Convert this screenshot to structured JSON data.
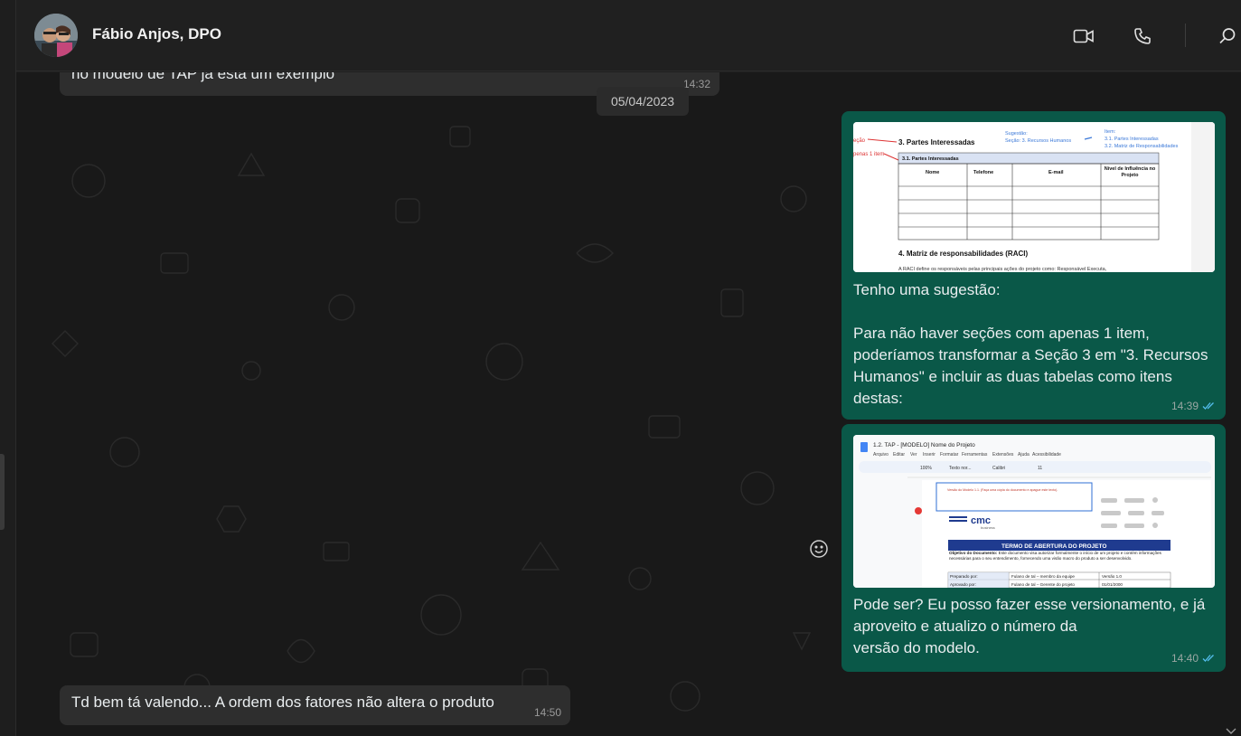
{
  "header": {
    "contact_name": "Fábio Anjos, DPO"
  },
  "messages": {
    "m1": {
      "text": "no modelo de TAP já está um exemplo",
      "time": "14:32"
    },
    "date_separator": "05/04/2023",
    "m2": {
      "text": "Tenho uma sugestão:\n\nPara não haver seções com apenas 1 item, poderíamos transformar a Seção 3 em \"3. Recursos Humanos\" e incluir as duas tabelas como itens destas:",
      "time": "14:39",
      "image": {
        "annot_left_1": "eção",
        "annot_left_2": "penas 1 item",
        "heading": "3. Partes Interessadas",
        "suggestion_title": "Sugestão:",
        "suggestion_text": "Seção: 3. Recursos Humanos",
        "item_title": "Item:",
        "item_1": "3.1. Partes Interessadas",
        "item_2": "3.2. Matriz de Responsabilidades",
        "subheading": "3.1. Partes Interessadas",
        "table_headers": [
          "Nome",
          "Telefone",
          "E-mail",
          "Nível de Influência no Projeto"
        ],
        "section_4": "4. Matriz de responsabilidades (RACI)",
        "section_4_text": "A RACI define os responsáveis pelas principais ações do projeto como: Responsável Executa,"
      }
    },
    "m3": {
      "text": "Pode ser? Eu posso fazer esse versionamento, e já aproveito e atualizo o número da\nversão do modelo.",
      "time": "14:40",
      "image": {
        "doc_title": "1.2. TAP - [MODELO] Nome do Projeto",
        "menu": [
          "Arquivo",
          "Editar",
          "Ver",
          "Inserir",
          "Formatar",
          "Ferramentas",
          "Extensões",
          "Ajuda",
          "Acessibilidade"
        ],
        "zoom": "100%",
        "style": "Texto nor...",
        "font": "Calibri",
        "font_size": "11",
        "version_note": "Versão do Modelo 1.1. (Faça uma cópia do documento e apague este texto).",
        "logo": "cmc",
        "logo_sub": "business",
        "banner": "TERMO DE ABERTURA DO PROJETO",
        "objective_label": "Objetivo do Documento:",
        "objective_text": "Este documento visa autorizar formalmente o início de um projeto e contém informações necessárias para o seu entendimento, fornecendo uma visão macro do produto a ser desenvolvido.",
        "prepared_label": "Preparado por:",
        "prepared_value": "Fulano de tal – membro da equipe",
        "version_value": "Versão 1.0",
        "approved_label": "Aprovado por:",
        "approved_value": "Fulano de tal – Gerente do projeto",
        "date_value": "01/01/2000"
      }
    },
    "m4": {
      "text": "Td bem tá valendo... A ordem dos fatores não altera o produto",
      "time": "14:50"
    }
  },
  "colors": {
    "outgoing_bubble": "#0a5848",
    "incoming_bubble": "#2e2e2e",
    "read_ticks": "#53bdeb",
    "background": "#191919"
  },
  "icons": [
    "video-call-icon",
    "voice-call-icon",
    "search-icon",
    "emoji-icon",
    "read-receipt-icon",
    "scroll-down-icon"
  ]
}
